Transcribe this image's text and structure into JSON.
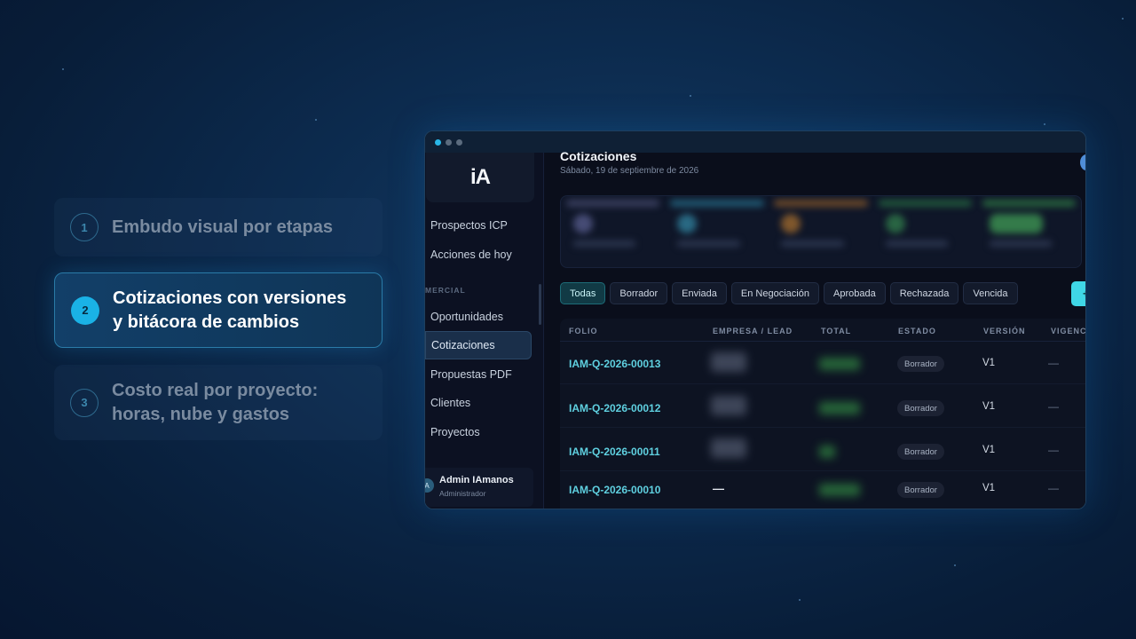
{
  "features": [
    {
      "num": "1",
      "text": "Embudo visual por etapas",
      "state": "inactive"
    },
    {
      "num": "2",
      "text": "Cotizaciones con versiones y bitácora de cambios",
      "line1": "Cotizaciones con versiones",
      "line2": "y bitácora de cambios",
      "state": "active"
    },
    {
      "num": "3",
      "text": "Costo real por proyecto: horas, nube y gastos",
      "line1": "Costo real por proyecto:",
      "line2": "horas, nube y gastos",
      "state": "inactive"
    }
  ],
  "app": {
    "logo": "iA",
    "sidebar": {
      "items_top": [
        {
          "label": "Prospectos ICP"
        },
        {
          "label": "Acciones de hoy"
        }
      ],
      "section_label": "MERCIAL",
      "items": [
        {
          "label": "Oportunidades"
        },
        {
          "label": "Cotizaciones",
          "active": true
        },
        {
          "label": "Propuestas PDF"
        },
        {
          "label": "Clientes"
        },
        {
          "label": "Proyectos"
        }
      ],
      "user": {
        "initial": "A",
        "name": "Admin IAmanos",
        "role": "Administrador"
      }
    },
    "header": {
      "title": "Cotizaciones",
      "date": "Sábado, 19 de septiembre de 2026"
    },
    "filters": [
      "Todas",
      "Borrador",
      "Enviada",
      "En Negociación",
      "Aprobada",
      "Rechazada",
      "Vencida"
    ],
    "active_filter": "Todas",
    "new_button": "+",
    "table": {
      "columns": [
        "FOLIO",
        "EMPRESA / LEAD",
        "TOTAL",
        "ESTADO",
        "VERSIÓN",
        "VIGENCI"
      ],
      "rows": [
        {
          "folio": "IAM-Q-2026-00013",
          "empresa": "",
          "estado": "Borrador",
          "version": "V1",
          "vigencia": "—"
        },
        {
          "folio": "IAM-Q-2026-00012",
          "empresa": "",
          "estado": "Borrador",
          "version": "V1",
          "vigencia": "—"
        },
        {
          "folio": "IAM-Q-2026-00011",
          "empresa": "",
          "estado": "Borrador",
          "version": "V1",
          "vigencia": "—"
        },
        {
          "folio": "IAM-Q-2026-00010",
          "empresa": "—",
          "estado": "Borrador",
          "version": "V1",
          "vigencia": "—"
        }
      ]
    }
  }
}
